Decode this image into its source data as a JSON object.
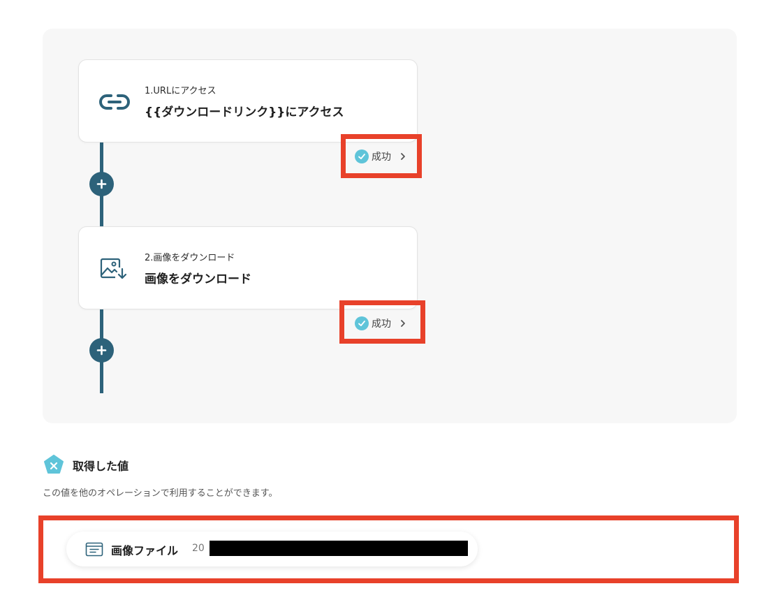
{
  "colors": {
    "accent": "#2d627a",
    "success": "#5fc4d9",
    "highlight": "#e8412a",
    "panel": "#f7f7f7"
  },
  "flow": {
    "operations": [
      {
        "step_label": "1.URLにアクセス",
        "title": "{{ダウンロードリンク}}にアクセス",
        "icon": "link-icon",
        "status": "成功"
      },
      {
        "step_label": "2.画像をダウンロード",
        "title": "画像をダウンロード",
        "icon": "image-download-icon",
        "status": "成功"
      }
    ]
  },
  "output": {
    "icon": "pentagon-x-icon",
    "title": "取得した値",
    "description": "この値を他のオペレーションで利用することができます。",
    "values": [
      {
        "icon": "window-list-icon",
        "label": "画像ファイル",
        "value_prefix": "20"
      }
    ]
  }
}
